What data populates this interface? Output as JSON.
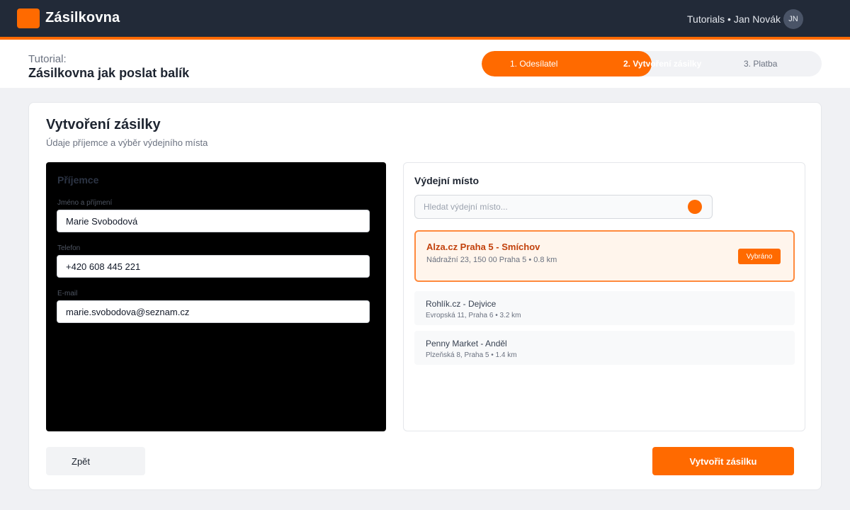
{
  "header": {
    "brand": "Zásilkovna",
    "user_text": "Tutorials • Jan Novák",
    "avatar_initials": "JN",
    "accent_color": "#ff6a00",
    "logo_icon": "logo-square-icon"
  },
  "tutorial": {
    "label": "Tutorial:",
    "title": "Zásilkovna jak poslat balík"
  },
  "stepper": {
    "steps": [
      {
        "label": "1. Odesílatel",
        "state": "done"
      },
      {
        "label": "2. Vytvoření zásilky",
        "state": "active"
      },
      {
        "label": "3. Platba",
        "state": "pending"
      }
    ],
    "progress_fraction": 0.5
  },
  "form": {
    "title": "Vytvoření zásilky",
    "subtitle": "Údaje příjemce a výběr výdejního místa"
  },
  "recipient": {
    "title": "Příjemce",
    "name_label": "Jméno a příjmení",
    "name_value": "Marie Svobodová",
    "phone_label": "Telefon",
    "phone_value": "+420 608 445 221",
    "email_label": "E-mail",
    "email_value": "marie.svobodova@seznam.cz"
  },
  "pickup": {
    "title": "Výdejní místo",
    "search_placeholder": "Hledat výdejní místo...",
    "search_icon": "search-dot-icon",
    "selected": {
      "name": "Alza.cz Praha 5 - Smíchov",
      "address": "Nádražní 23, 150 00 Praha 5 • 0.8 km",
      "badge": "Vybráno"
    },
    "others": [
      {
        "name": "Rohlík.cz - Dejvice",
        "address": "Evropská 11, Praha 6 • 3.2 km"
      },
      {
        "name": "Penny Market - Anděl",
        "address": "Plzeňská 8, Praha 5 • 1.4 km"
      }
    ]
  },
  "actions": {
    "back_label": "Zpět",
    "create_label": "Vytvořit zásilku"
  }
}
